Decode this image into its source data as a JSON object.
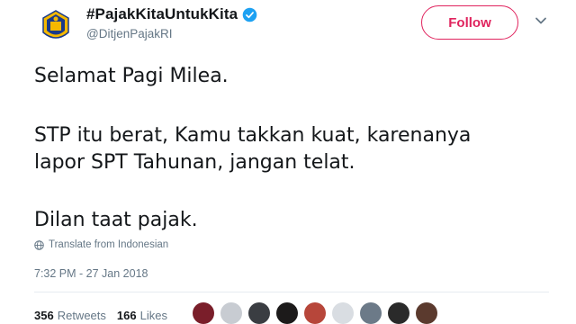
{
  "account": {
    "display_name": "#PajakKitaUntukKita",
    "handle": "@DitjenPajakRI",
    "verified": true
  },
  "follow_button": {
    "label": "Follow"
  },
  "tweet": {
    "lines": [
      "Selamat Pagi Milea.",
      "STP itu berat, Kamu takkan kuat, karenanya",
      "lapor SPT Tahunan, jangan telat.",
      "Dilan taat pajak."
    ],
    "translate_label": "Translate from Indonesian",
    "timestamp": "7:32 PM - 27 Jan 2018"
  },
  "stats": {
    "retweets_count": "356",
    "retweets_label": "Retweets",
    "likes_count": "166",
    "likes_label": "Likes"
  },
  "colors": {
    "accent": "#e0245e",
    "verified": "#1da1f2",
    "secondary_text": "#657786"
  },
  "icons": [
    "ministry-logo-icon",
    "verified-badge-icon",
    "chevron-down-icon",
    "globe-icon"
  ]
}
